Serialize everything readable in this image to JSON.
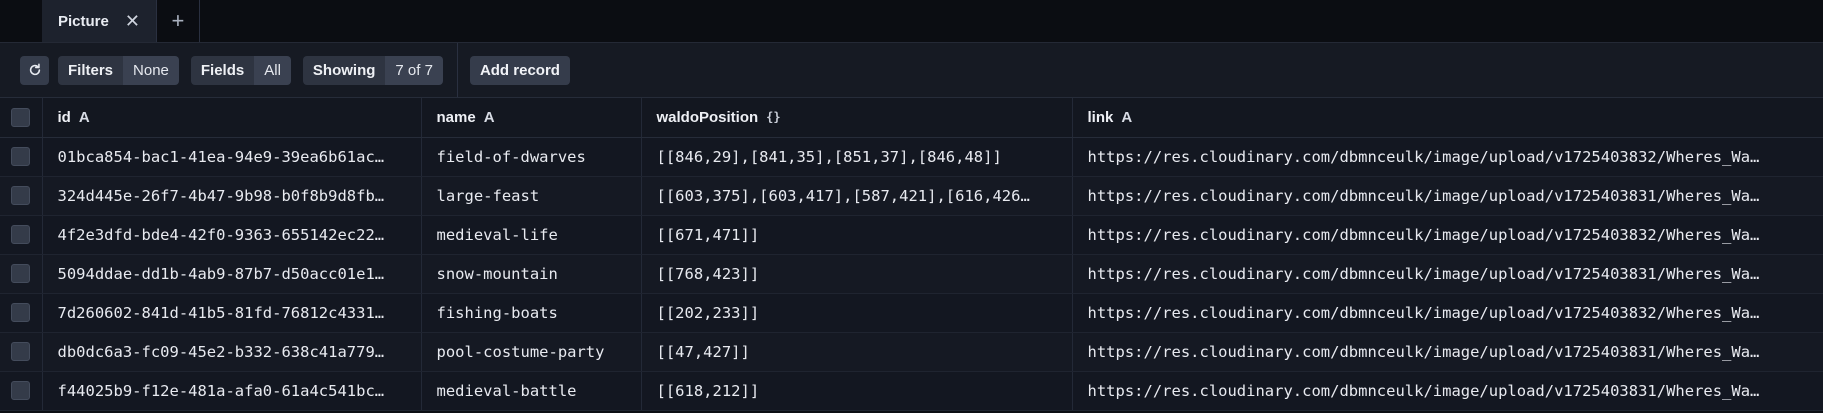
{
  "tabs": [
    {
      "label": "Picture"
    }
  ],
  "toolbar": {
    "filters_key": "Filters",
    "filters_val": "None",
    "fields_key": "Fields",
    "fields_val": "All",
    "showing_key": "Showing",
    "showing_val": "7 of 7",
    "add_record": "Add record"
  },
  "table": {
    "columns": [
      {
        "label": "id",
        "type": "A"
      },
      {
        "label": "name",
        "type": "A"
      },
      {
        "label": "waldoPosition",
        "type": "{}"
      },
      {
        "label": "link",
        "type": "A"
      }
    ],
    "rows": [
      {
        "id": "01bca854-bac1-41ea-94e9-39ea6b61ac…",
        "name": "field-of-dwarves",
        "waldoPosition": "[[846,29],[841,35],[851,37],[846,48]]",
        "link": "https://res.cloudinary.com/dbmnceulk/image/upload/v1725403832/Wheres_Wa…"
      },
      {
        "id": "324d445e-26f7-4b47-9b98-b0f8b9d8fb…",
        "name": "large-feast",
        "waldoPosition": "[[603,375],[603,417],[587,421],[616,426…",
        "link": "https://res.cloudinary.com/dbmnceulk/image/upload/v1725403831/Wheres_Wa…"
      },
      {
        "id": "4f2e3dfd-bde4-42f0-9363-655142ec22…",
        "name": "medieval-life",
        "waldoPosition": "[[671,471]]",
        "link": "https://res.cloudinary.com/dbmnceulk/image/upload/v1725403832/Wheres_Wa…"
      },
      {
        "id": "5094ddae-dd1b-4ab9-87b7-d50acc01e1…",
        "name": "snow-mountain",
        "waldoPosition": "[[768,423]]",
        "link": "https://res.cloudinary.com/dbmnceulk/image/upload/v1725403831/Wheres_Wa…"
      },
      {
        "id": "7d260602-841d-41b5-81fd-76812c4331…",
        "name": "fishing-boats",
        "waldoPosition": "[[202,233]]",
        "link": "https://res.cloudinary.com/dbmnceulk/image/upload/v1725403832/Wheres_Wa…"
      },
      {
        "id": "db0dc6a3-fc09-45e2-b332-638c41a779…",
        "name": "pool-costume-party",
        "waldoPosition": "[[47,427]]",
        "link": "https://res.cloudinary.com/dbmnceulk/image/upload/v1725403831/Wheres_Wa…"
      },
      {
        "id": "f44025b9-f12e-481a-afa0-61a4c541bc…",
        "name": "medieval-battle",
        "waldoPosition": "[[618,212]]",
        "link": "https://res.cloudinary.com/dbmnceulk/image/upload/v1725403831/Wheres_Wa…"
      }
    ]
  }
}
